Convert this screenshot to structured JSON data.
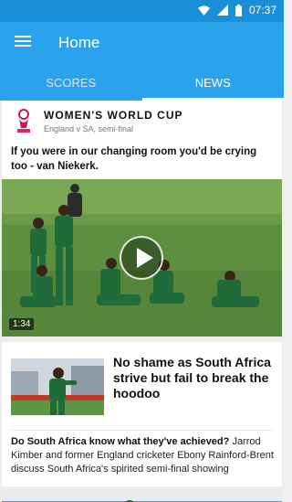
{
  "status_bar": {
    "time": "07:37",
    "icons": [
      "wifi-icon",
      "signal-icon",
      "battery-icon"
    ]
  },
  "app_bar": {
    "menu_icon": "hamburger-menu-icon",
    "title": "Home"
  },
  "tabs": [
    {
      "label": "SCORES",
      "active": false
    },
    {
      "label": "NEWS",
      "active": true
    }
  ],
  "video_card": {
    "competition": "WOMEN'S WORLD CUP",
    "match": "England v SA, semi-final",
    "headline": "If you were in our changing room you'd be crying too - van Niekerk.",
    "duration": "1:34",
    "play_icon": "play-icon"
  },
  "article_card": {
    "headline": "No shame as South Africa strive but fail to break the hoodoo",
    "summary_bold": "Do South Africa know what they've achieved?",
    "summary_text": "Jarrod Kimber and former England cricketer Ebony Rainford-Brent discuss South Africa's spirited semi-final showing"
  },
  "colors": {
    "status_bar": "#1a8fd8",
    "app_bar": "#2aa3ec",
    "pitch": "#5d8f3f",
    "team_kit": "#1f6b3a"
  }
}
